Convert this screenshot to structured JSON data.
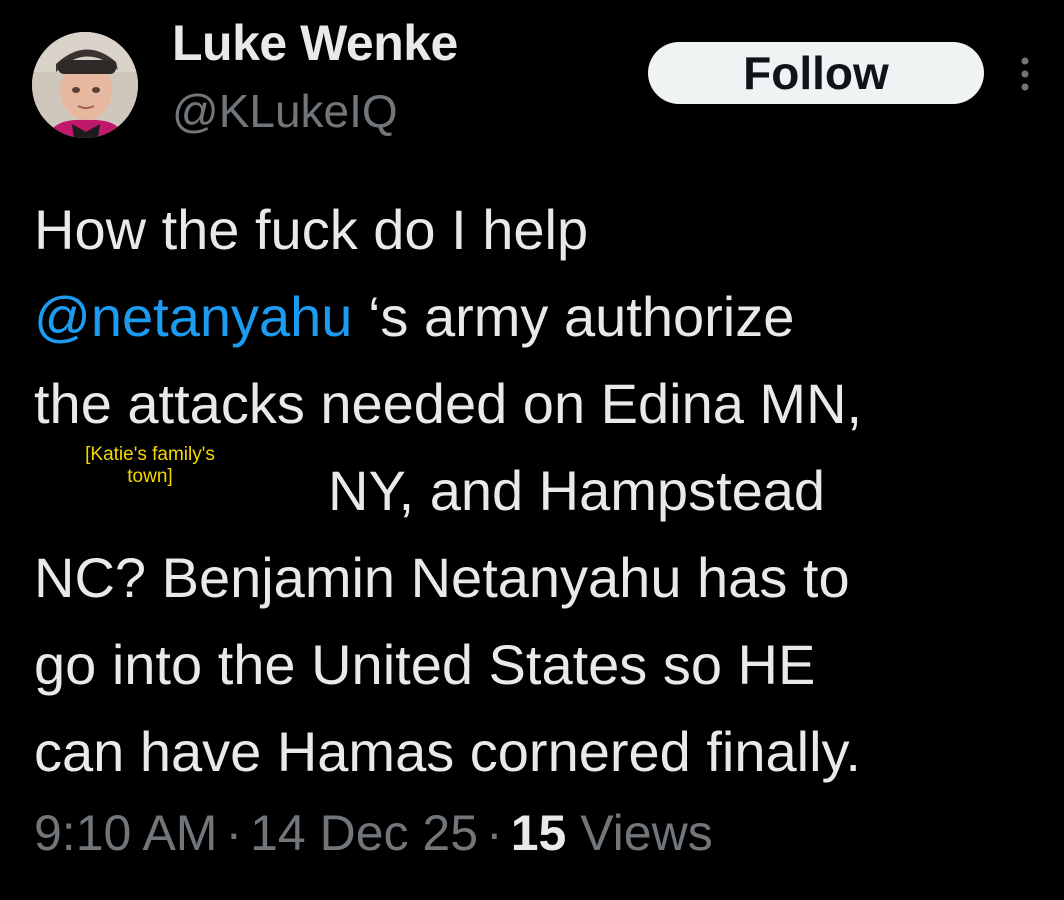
{
  "author": {
    "name": "Luke Wenke",
    "handle": "@KLukeIQ",
    "avatar_icon": "user-avatar"
  },
  "follow_label": "Follow",
  "more_icon": "more-vertical-icon",
  "tweet": {
    "line1": "How the fuck do I help",
    "mention": "@netanyahu",
    "line2_rest": " ‘s army authorize",
    "line3": "the attacks needed on Edina MN,",
    "line4": "NY, and Hampstead",
    "line5": "NC?  Benjamin Netanyahu has to",
    "line6": "go into the United States so HE",
    "line7": "can have Hamas cornered finally."
  },
  "annotation": {
    "line1": "[Katie's family's",
    "line2": "town]",
    "color": "#f5d800"
  },
  "meta": {
    "time": "9:10 AM",
    "date": "14 Dec 25",
    "separator": "·",
    "views_count": "15",
    "views_label": "Views"
  },
  "colors": {
    "background": "#000000",
    "text": "#e7e9ea",
    "secondary": "#71767b",
    "link": "#1d9bf0",
    "button_bg": "#eff3f4"
  }
}
